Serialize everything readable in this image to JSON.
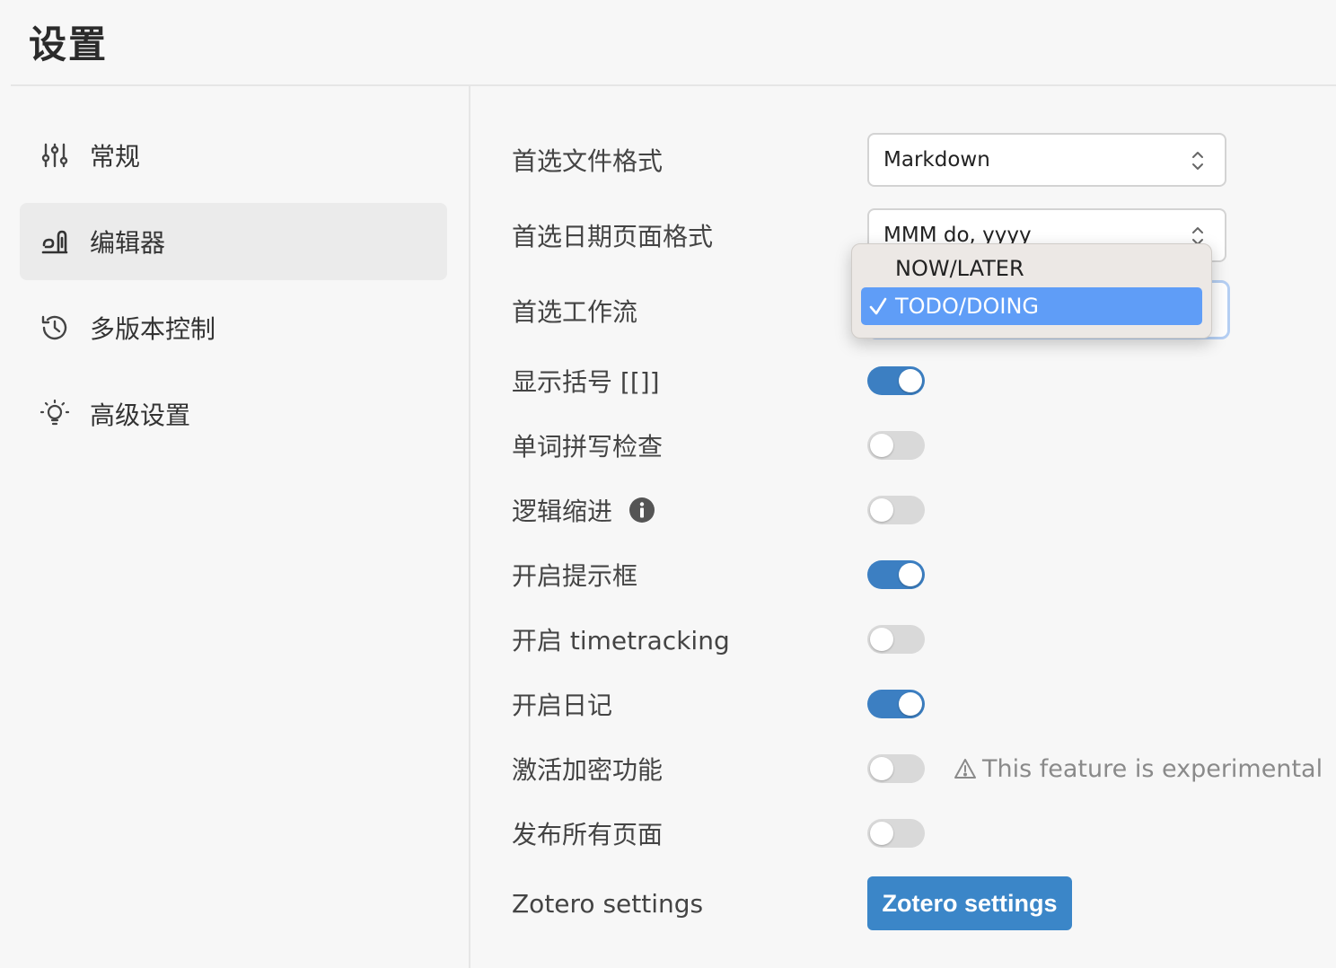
{
  "window": {
    "title": "设置"
  },
  "sidebar": {
    "items": [
      {
        "label": "常规",
        "icon": "sliders-icon",
        "active": false
      },
      {
        "label": "编辑器",
        "icon": "editor-icon",
        "active": true
      },
      {
        "label": "多版本控制",
        "icon": "history-icon",
        "active": false
      },
      {
        "label": "高级设置",
        "icon": "lightbulb-icon",
        "active": false
      }
    ]
  },
  "settings": {
    "file_format": {
      "label": "首选文件格式",
      "value": "Markdown"
    },
    "date_format": {
      "label": "首选日期页面格式",
      "value": "MMM do, yyyy"
    },
    "workflow": {
      "label": "首选工作流",
      "value": "TODO/DOING"
    },
    "brackets": {
      "label": "显示括号 [[]]",
      "on": true
    },
    "spellcheck": {
      "label": "单词拼写检查",
      "on": false
    },
    "logical_indent": {
      "label": "逻辑缩进",
      "on": false
    },
    "tooltips": {
      "label": "开启提示框",
      "on": true
    },
    "timetracking": {
      "label": "开启 timetracking",
      "on": false
    },
    "journals": {
      "label": "开启日记",
      "on": true
    },
    "encryption": {
      "label": "激活加密功能",
      "on": false,
      "warning": "This feature is experimental"
    },
    "publish_all": {
      "label": "发布所有页面",
      "on": false
    },
    "zotero": {
      "label": "Zotero settings",
      "button_label": "Zotero settings"
    }
  },
  "dropdown": {
    "options": [
      {
        "label": "NOW/LATER",
        "selected": false
      },
      {
        "label": "TODO/DOING",
        "selected": true
      }
    ]
  },
  "colors": {
    "accent": "#3c7fc2",
    "toggle_off": "#d9d9d9",
    "dropdown_highlight": "#5f9df7",
    "sidebar_active": "#ebebeb"
  }
}
